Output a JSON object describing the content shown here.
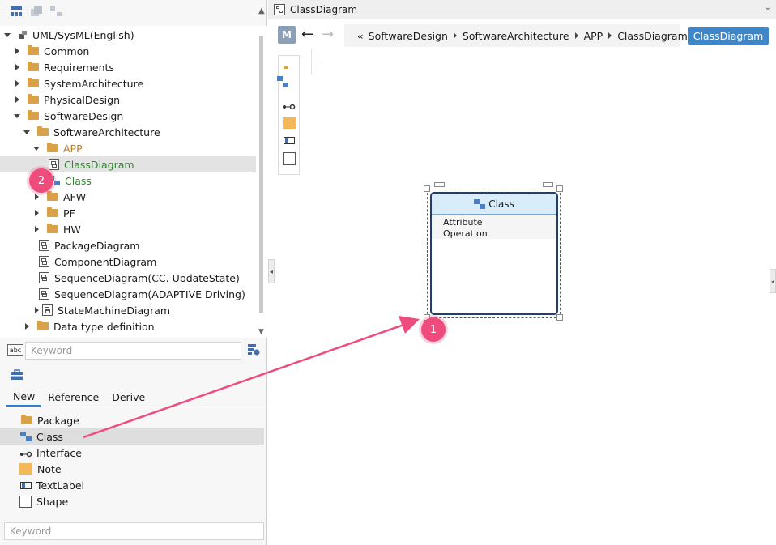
{
  "tree": {
    "root": "UML/SysML(English)",
    "items": [
      "Common",
      "Requirements",
      "SystemArchitecture",
      "PhysicalDesign",
      "SoftwareDesign",
      "SoftwareArchitecture",
      "APP",
      "ClassDiagram",
      "Class",
      "AFW",
      "PF",
      "HW",
      "PackageDiagram",
      "ComponentDiagram",
      "SequenceDiagram(CC. UpdateState)",
      "SequenceDiagram(ADAPTIVE Driving)",
      "StateMachineDiagram",
      "Data type definition"
    ],
    "keyword_placeholder": "Keyword"
  },
  "palette": {
    "tabs": [
      "New",
      "Reference",
      "Derive"
    ],
    "items": [
      "Package",
      "Class",
      "Interface",
      "Note",
      "TextLabel",
      "Shape"
    ],
    "keyword_placeholder": "Keyword"
  },
  "editor": {
    "tab_title": "ClassDiagram",
    "m_button": "M",
    "breadcrumb_prefix": "«",
    "breadcrumb": [
      "SoftwareDesign",
      "SoftwareArchitecture",
      "APP",
      "ClassDiagram"
    ],
    "view_button": "ClassDiagram"
  },
  "class_node": {
    "title": "Class",
    "attribute": "Attribute",
    "operation": "Operation"
  },
  "annotations": {
    "badge1": "1",
    "badge2": "2",
    "color": "#ee4c7c"
  }
}
